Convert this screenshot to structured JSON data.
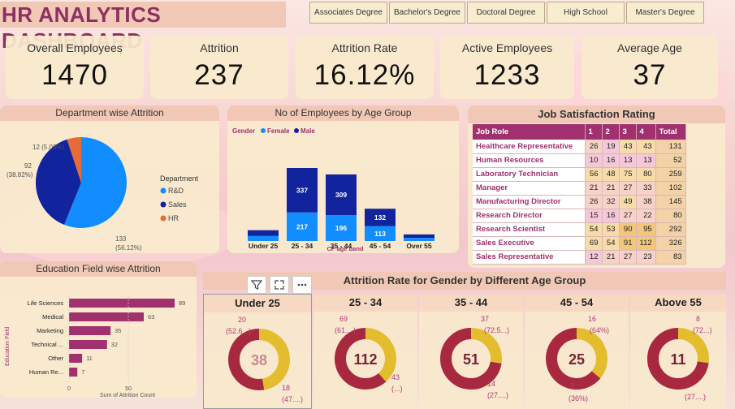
{
  "title": "HR ANALYTICS DASHBOARD",
  "slicers": [
    "Associates Degree",
    "Bachelor's Degree",
    "Doctoral Degree",
    "High School",
    "Master's Degree"
  ],
  "kpis": [
    {
      "label": "Overall Employees",
      "value": "1470"
    },
    {
      "label": "Attrition",
      "value": "237"
    },
    {
      "label": "Attrition Rate",
      "value": "16.12%"
    },
    {
      "label": "Active Employees",
      "value": "1233"
    },
    {
      "label": "Average Age",
      "value": "37"
    }
  ],
  "dept": {
    "title": "Department wise Attrition",
    "legend_title": "Department",
    "legend": [
      "R&D",
      "Sales",
      "HR"
    ],
    "labels": {
      "hr": "12 (5.06%)",
      "sales_a": "92",
      "sales_b": "(38.82%)",
      "rd_a": "133",
      "rd_b": "(56.12%)"
    }
  },
  "age": {
    "title": "No of Employees by Age Group",
    "legend_title": "Gender",
    "legend_female": "Female",
    "legend_male": "Male",
    "xlabel": "CF age band"
  },
  "jobsat": {
    "title": "Job Satisfaction Rating",
    "headers": [
      "Job Role",
      "1",
      "2",
      "3",
      "4",
      "Total"
    ],
    "rows": [
      [
        "Healthcare Representative",
        "26",
        "19",
        "43",
        "43",
        "131"
      ],
      [
        "Human Resources",
        "10",
        "16",
        "13",
        "13",
        "52"
      ],
      [
        "Laboratory Technician",
        "56",
        "48",
        "75",
        "80",
        "259"
      ],
      [
        "Manager",
        "21",
        "21",
        "27",
        "33",
        "102"
      ],
      [
        "Manufacturing Director",
        "26",
        "32",
        "49",
        "38",
        "145"
      ],
      [
        "Research Director",
        "15",
        "16",
        "27",
        "22",
        "80"
      ],
      [
        "Research Scientist",
        "54",
        "53",
        "90",
        "95",
        "292"
      ],
      [
        "Sales Executive",
        "69",
        "54",
        "91",
        "112",
        "326"
      ],
      [
        "Sales Representative",
        "12",
        "21",
        "27",
        "23",
        "83"
      ]
    ]
  },
  "edu": {
    "title": "Education Field wise Attrition",
    "ylabel": "Education Field",
    "xlabel": "Sum of Attrition Count"
  },
  "gender": {
    "title": "Attrition Rate for Gender by Different Age Group",
    "groups": [
      {
        "label": "Under 25",
        "center": "38",
        "top": "20",
        "top2": "(52.6...)",
        "bot": "18",
        "bot2": "(47....)"
      },
      {
        "label": "25 - 34",
        "center": "112",
        "top": "69",
        "top2": "(61....)",
        "bot": "43",
        "bot2": "(...)"
      },
      {
        "label": "35 - 44",
        "center": "51",
        "top": "37",
        "top2": "(72.5...)",
        "bot": "14",
        "bot2": "(27....)"
      },
      {
        "label": "45 - 54",
        "center": "25",
        "top": "16",
        "top2": "(64%)",
        "bot": "9",
        "bot2": "(36%)"
      },
      {
        "label": "Above 55",
        "center": "11",
        "top": "8",
        "top2": "(72...)",
        "bot": "3",
        "bot2": "(27....)"
      }
    ]
  },
  "chart_data": [
    {
      "type": "pie",
      "title": "Department wise Attrition",
      "categories": [
        "R&D",
        "Sales",
        "HR"
      ],
      "values": [
        133,
        92,
        12
      ],
      "colors": [
        "#118dff",
        "#12239e",
        "#e66c37"
      ]
    },
    {
      "type": "bar",
      "title": "No of Employees by Age Group",
      "categories": [
        "Under 25",
        "25 - 34",
        "35 - 44",
        "45 - 54",
        "Over 55"
      ],
      "series": [
        {
          "name": "Female",
          "values": [
            38,
            217,
            196,
            113,
            24
          ]
        },
        {
          "name": "Male",
          "values": [
            44,
            337,
            309,
            132,
            26
          ]
        }
      ],
      "data_labels": {
        "Female": [
          null,
          "217",
          "196",
          "113",
          null
        ],
        "Male": [
          null,
          "337",
          "309",
          "132",
          null
        ]
      },
      "xlabel": "CF age band",
      "colors": [
        "#118dff",
        "#12239e"
      ]
    },
    {
      "type": "bar",
      "title": "Education Field wise Attrition",
      "categories": [
        "Life Sciences",
        "Medical",
        "Marketing",
        "Technical ...",
        "Other",
        "Human Re..."
      ],
      "values": [
        89,
        63,
        35,
        32,
        11,
        7
      ],
      "xlabel": "Sum of Attrition Count",
      "ylabel": "Education Field",
      "xticks": [
        "0",
        "50"
      ],
      "xlim": [
        0,
        95
      ],
      "color": "#a0306e"
    },
    {
      "type": "pie",
      "title": "Attrition Rate for Gender by Different Age Group",
      "categories": [
        "Under 25",
        "25 - 34",
        "35 - 44",
        "45 - 54",
        "Above 55"
      ],
      "series": [
        {
          "values": [
            20,
            69,
            37,
            16,
            8
          ]
        },
        {
          "values": [
            18,
            43,
            14,
            9,
            3
          ]
        }
      ],
      "colors": [
        "#a8293f",
        "#e3bd2e"
      ]
    }
  ],
  "colors": {
    "accent": "#a0306e",
    "title_bg": "#f0c8b5",
    "panel": "#f8eacd"
  },
  "icons": [
    "filter-icon",
    "focus-mode-icon",
    "more-options-icon"
  ]
}
